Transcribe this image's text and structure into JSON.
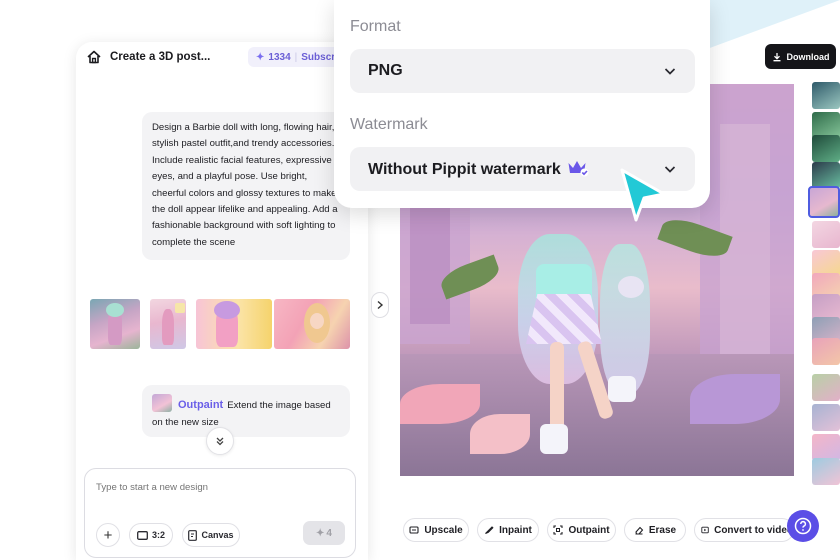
{
  "chat": {
    "title": "Create a 3D post...",
    "credits": "1334",
    "subscribe": "Subscr",
    "prompt": "Design a Barbie doll with long, flowing hair, stylish pastel outfit,and trendy accessories. Include realistic facial features, expressive eyes, and a playful pose. Use bright, cheerful colors and glossy textures to make the doll appear lifelike and appealing. Add a fashionable background with soft lighting to complete the scene",
    "outpaint_label": "Outpaint",
    "outpaint_text": "Extend the image based on the new size",
    "input_placeholder": "Type to start a new design",
    "ratio_label": "3:2",
    "canvas_label": "Canvas",
    "send_cost": "4"
  },
  "popup": {
    "format_label": "Format",
    "format_value": "PNG",
    "watermark_label": "Watermark",
    "watermark_value": "Without Pippit watermark"
  },
  "toolbar": {
    "download_label": "Download"
  },
  "actions": {
    "upscale": "Upscale",
    "inpaint": "Inpaint",
    "outpaint": "Outpaint",
    "erase": "Erase",
    "convert": "Convert to video"
  },
  "icons": {
    "home": "home-icon",
    "sparkle": "sparkle-icon",
    "chevron": "chevron-down-icon",
    "crown": "crown-icon",
    "help": "help-icon"
  },
  "colors": {
    "accent": "#5b4ee6",
    "download_bg": "#151519",
    "popup_select_bg": "#f1f1f3",
    "cursor": "#22c9d6"
  }
}
